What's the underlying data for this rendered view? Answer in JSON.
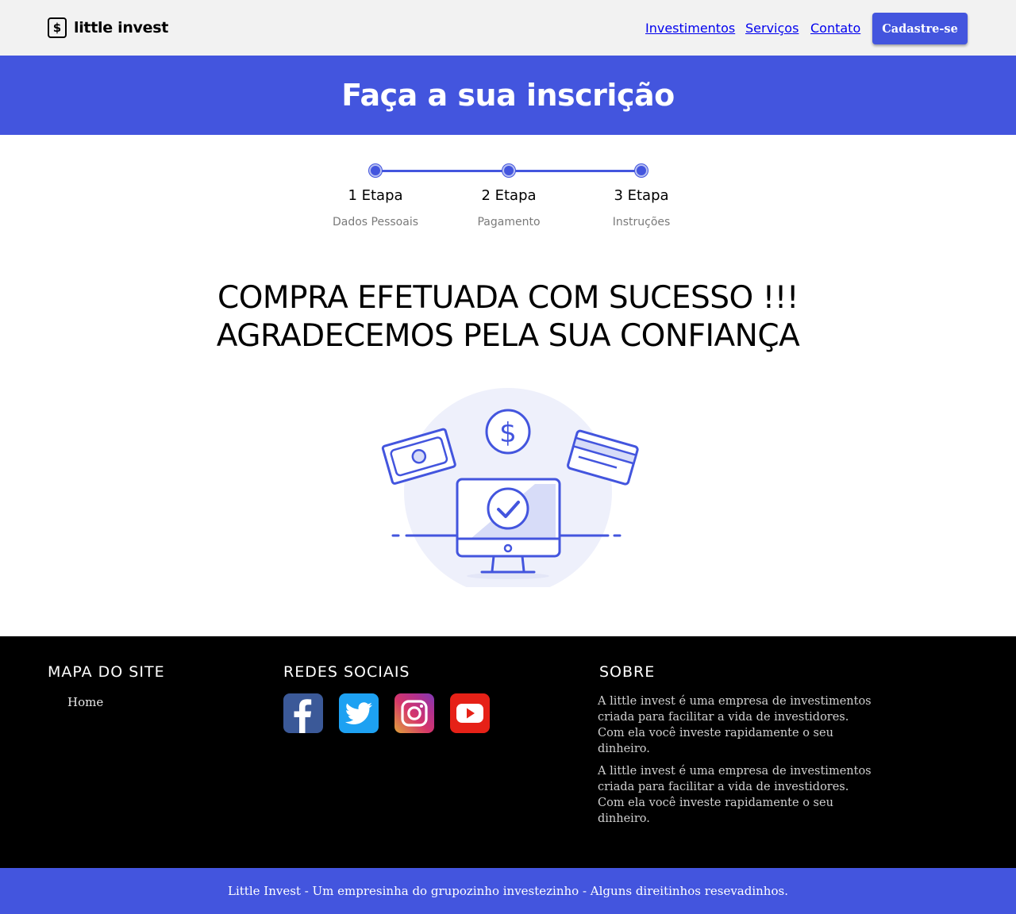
{
  "header": {
    "brand_icon_glyph": "$",
    "brand_name": "little invest",
    "nav": [
      "Investimentos",
      "Serviços",
      "Contato"
    ],
    "cta_label": "Cadastre-se"
  },
  "banner": {
    "title": "Faça a sua inscrição"
  },
  "stepper": {
    "steps": [
      {
        "title": "1 Etapa",
        "subtitle": "Dados Pessoais"
      },
      {
        "title": "2 Etapa",
        "subtitle": "Pagamento"
      },
      {
        "title": "3 Etapa",
        "subtitle": "Instruções"
      }
    ]
  },
  "message": {
    "line1": "COMPRA EFETUADA COM SUCESSO !!!",
    "line2": "AGRADECEMOS PELA SUA CONFIANÇA"
  },
  "illustration": {
    "icons": [
      "banknote-icon",
      "dollar-coin-icon",
      "credit-card-icon",
      "monitor-check-icon"
    ],
    "accent": "#4355de",
    "soft": "#eef0fb"
  },
  "footer": {
    "sitemap": {
      "heading": "MAPA DO SITE",
      "links": [
        "Home"
      ]
    },
    "social": {
      "heading": "REDES SOCIAIS",
      "icons": [
        {
          "name": "facebook-icon",
          "color": "#3b5998"
        },
        {
          "name": "twitter-icon",
          "color": "#1da1f2"
        },
        {
          "name": "instagram-icon",
          "color": "#c13584"
        },
        {
          "name": "youtube-icon",
          "color": "#e62117"
        }
      ]
    },
    "about": {
      "heading": "SOBRE",
      "paragraphs": [
        "A little invest é uma empresa de investimentos criada para facilitar a vida de investidores. Com ela você investe rapidamente o seu dinheiro.",
        "A little invest é uma empresa de investimentos criada para facilitar a vida de investidores. Com ela você investe rapidamente o seu dinheiro."
      ]
    }
  },
  "copyright": "Little Invest - Um empresinha do grupozinho investezinho - Alguns direitinhos resevadinhos.",
  "colors": {
    "primary": "#4355de",
    "topbar": "#f2f2f2",
    "footer": "#000000"
  }
}
